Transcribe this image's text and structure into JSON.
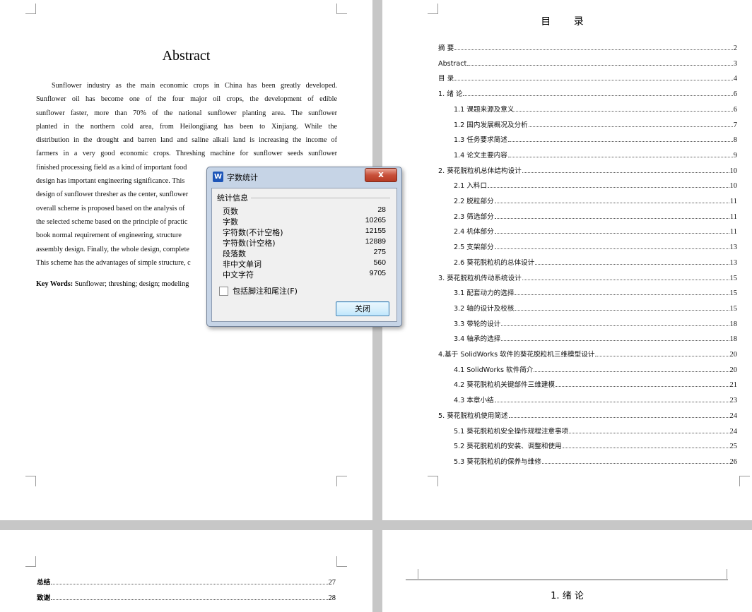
{
  "abstract": {
    "title": "Abstract",
    "lines": [
      "Sunflower industry as the main economic crops in China has been greatly developed.",
      "Sunflower oil has become one of the four major oil crops, the development of edible",
      "sunflower faster, more than 70% of the national sunflower planting area. The sunflower",
      "planted in the northern cold area, from Heilongjiang has been to Xinjiang. While the",
      "distribution in the drought and barren land and saline alkali land is increasing the income of",
      "farmers in a very good economic crops. Threshing machine for sunflower seeds sunflower",
      "finished processing field as a kind of important food",
      "design has important engineering significance. This",
      "design of sunflower thresher as the center, sunflower",
      "overall scheme is proposed based on the analysis of",
      "the selected scheme based on the principle of practic",
      "book normal requirement of engineering, structure",
      "assembly design. Finally, the whole design, complete",
      "This scheme has the advantages of simple structure, c"
    ],
    "keywords_label": "Key Words:",
    "keywords": "Sunflower; threshing; design; modeling"
  },
  "toc": {
    "title": "目 录",
    "entries": [
      {
        "text": "摘    要",
        "page": "2",
        "level": 0
      },
      {
        "text": "Abstract",
        "page": "3",
        "level": 0
      },
      {
        "text": "目    录",
        "page": "4",
        "level": 0
      },
      {
        "text": "1. 绪  论",
        "page": "6",
        "level": 0
      },
      {
        "text": "1.1 课题来源及意义",
        "page": "6",
        "level": 1
      },
      {
        "text": "1.2 国内发展概况及分析",
        "page": "7",
        "level": 1
      },
      {
        "text": "1.3 任务要求简述",
        "page": "8",
        "level": 1
      },
      {
        "text": "1.4 论文主要内容",
        "page": "9",
        "level": 1
      },
      {
        "text": "2. 葵花脱粒机总体结构设计",
        "page": "10",
        "level": 0
      },
      {
        "text": "2.1 入料口",
        "page": "10",
        "level": 1
      },
      {
        "text": "2.2 脱粒部分",
        "page": "11",
        "level": 1
      },
      {
        "text": "2.3 筛选部分",
        "page": "11",
        "level": 1
      },
      {
        "text": "2.4 机体部分",
        "page": "11",
        "level": 1
      },
      {
        "text": "2.5 支架部分",
        "page": "13",
        "level": 1
      },
      {
        "text": "2.6 葵花脱粒机的总体设计",
        "page": "13",
        "level": 1
      },
      {
        "text": "3. 葵花脱粒机传动系统设计",
        "page": "15",
        "level": 0
      },
      {
        "text": "3.1 配套动力的选择",
        "page": "15",
        "level": 1
      },
      {
        "text": "3.2 轴的设计及校核",
        "page": "15",
        "level": 1
      },
      {
        "text": "3.3 带轮的设计",
        "page": "18",
        "level": 1
      },
      {
        "text": "3.4 轴承的选择",
        "page": "18",
        "level": 1
      },
      {
        "text": "4.基于 SolidWorks 软件的葵花脱粒机三维模型设计",
        "page": "20",
        "level": 0
      },
      {
        "text": "4.1 SolidWorks 软件简介",
        "page": "20",
        "level": 1
      },
      {
        "text": "4.2 葵花脱粒机关键部件三维建模",
        "page": "21",
        "level": 1
      },
      {
        "text": "4.3 本章小结",
        "page": "23",
        "level": 1
      },
      {
        "text": "5. 葵花脱粒机使用简述",
        "page": "24",
        "level": 0
      },
      {
        "text": "5.1 葵花脱粒机安全操作规程注意事项",
        "page": "24",
        "level": 1
      },
      {
        "text": "5.2 葵花脱粒机的安装、调整和使用",
        "page": "25",
        "level": 1
      },
      {
        "text": "5.3 葵花脱粒机的保养与维修",
        "page": "26",
        "level": 1
      }
    ]
  },
  "bottom_left": {
    "entries": [
      {
        "text": "总结",
        "page": "27"
      },
      {
        "text": "致谢",
        "page": "28"
      }
    ]
  },
  "bottom_right": {
    "heading": "1. 绪  论"
  },
  "dialog": {
    "app_icon": "W",
    "title": "字数统计",
    "close_x": "x",
    "group_label": "统计信息",
    "stats": [
      {
        "label": "页数",
        "value": "28"
      },
      {
        "label": "字数",
        "value": "10265"
      },
      {
        "label": "字符数(不计空格)",
        "value": "12155"
      },
      {
        "label": "字符数(计空格)",
        "value": "12889"
      },
      {
        "label": "段落数",
        "value": "275"
      },
      {
        "label": "非中文单词",
        "value": "560"
      },
      {
        "label": "中文字符",
        "value": "9705"
      }
    ],
    "checkbox_label": "包括脚注和尾注(F)",
    "close_button": "关闭"
  }
}
